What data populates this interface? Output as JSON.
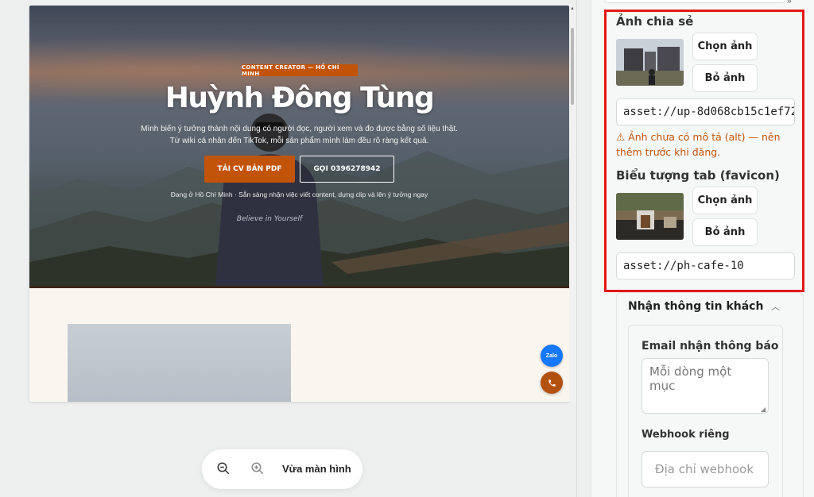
{
  "preview": {
    "eyebrow": "CONTENT CREATOR — HỒ CHÍ MINH",
    "name": "Huỳnh Đông Tùng",
    "subtitle_line1": "Mình biến ý tưởng thành nội dung có người đọc, người xem và đo được bằng số liệu thật.",
    "subtitle_line2": "Từ wiki cá nhân đến TikTok, mỗi sản phẩm mình làm đều rõ ràng kết quả.",
    "cv_button": "TẢI CV BẢN PDF",
    "call_button": "GỌI 0396278942",
    "meta": "Đang ở Hồ Chí Minh · Sẵn sàng nhận việc viết content, dựng clip và lên ý tưởng ngay",
    "shirt_text": "Believe in Yourself",
    "zalo_label": "Zalo"
  },
  "zoom": {
    "fit_label": "Vừa màn hình"
  },
  "panel": {
    "share_image": {
      "title": "Ảnh chia sẻ",
      "choose_label": "Chọn ảnh",
      "remove_label": "Bỏ ảnh",
      "asset_value": "asset://up-8d068cb15c1ef72",
      "warning": "⚠ Ảnh chưa có mô tả (alt) — nên thêm trước khi đăng."
    },
    "favicon": {
      "title": "Biểu tượng tab (favicon)",
      "choose_label": "Chọn ảnh",
      "remove_label": "Bỏ ảnh",
      "asset_value": "asset://ph-cafe-10"
    },
    "customer_info": {
      "title": "Nhận thông tin khách",
      "email_label": "Email nhận thông báo",
      "email_placeholder": "Mỗi dòng một mục",
      "webhook_label": "Webhook riêng",
      "webhook_placeholder": "Địa chỉ webhook"
    }
  },
  "colors": {
    "accent": "#c2540a",
    "highlight": "#e31818",
    "zalo": "#1677ff"
  }
}
